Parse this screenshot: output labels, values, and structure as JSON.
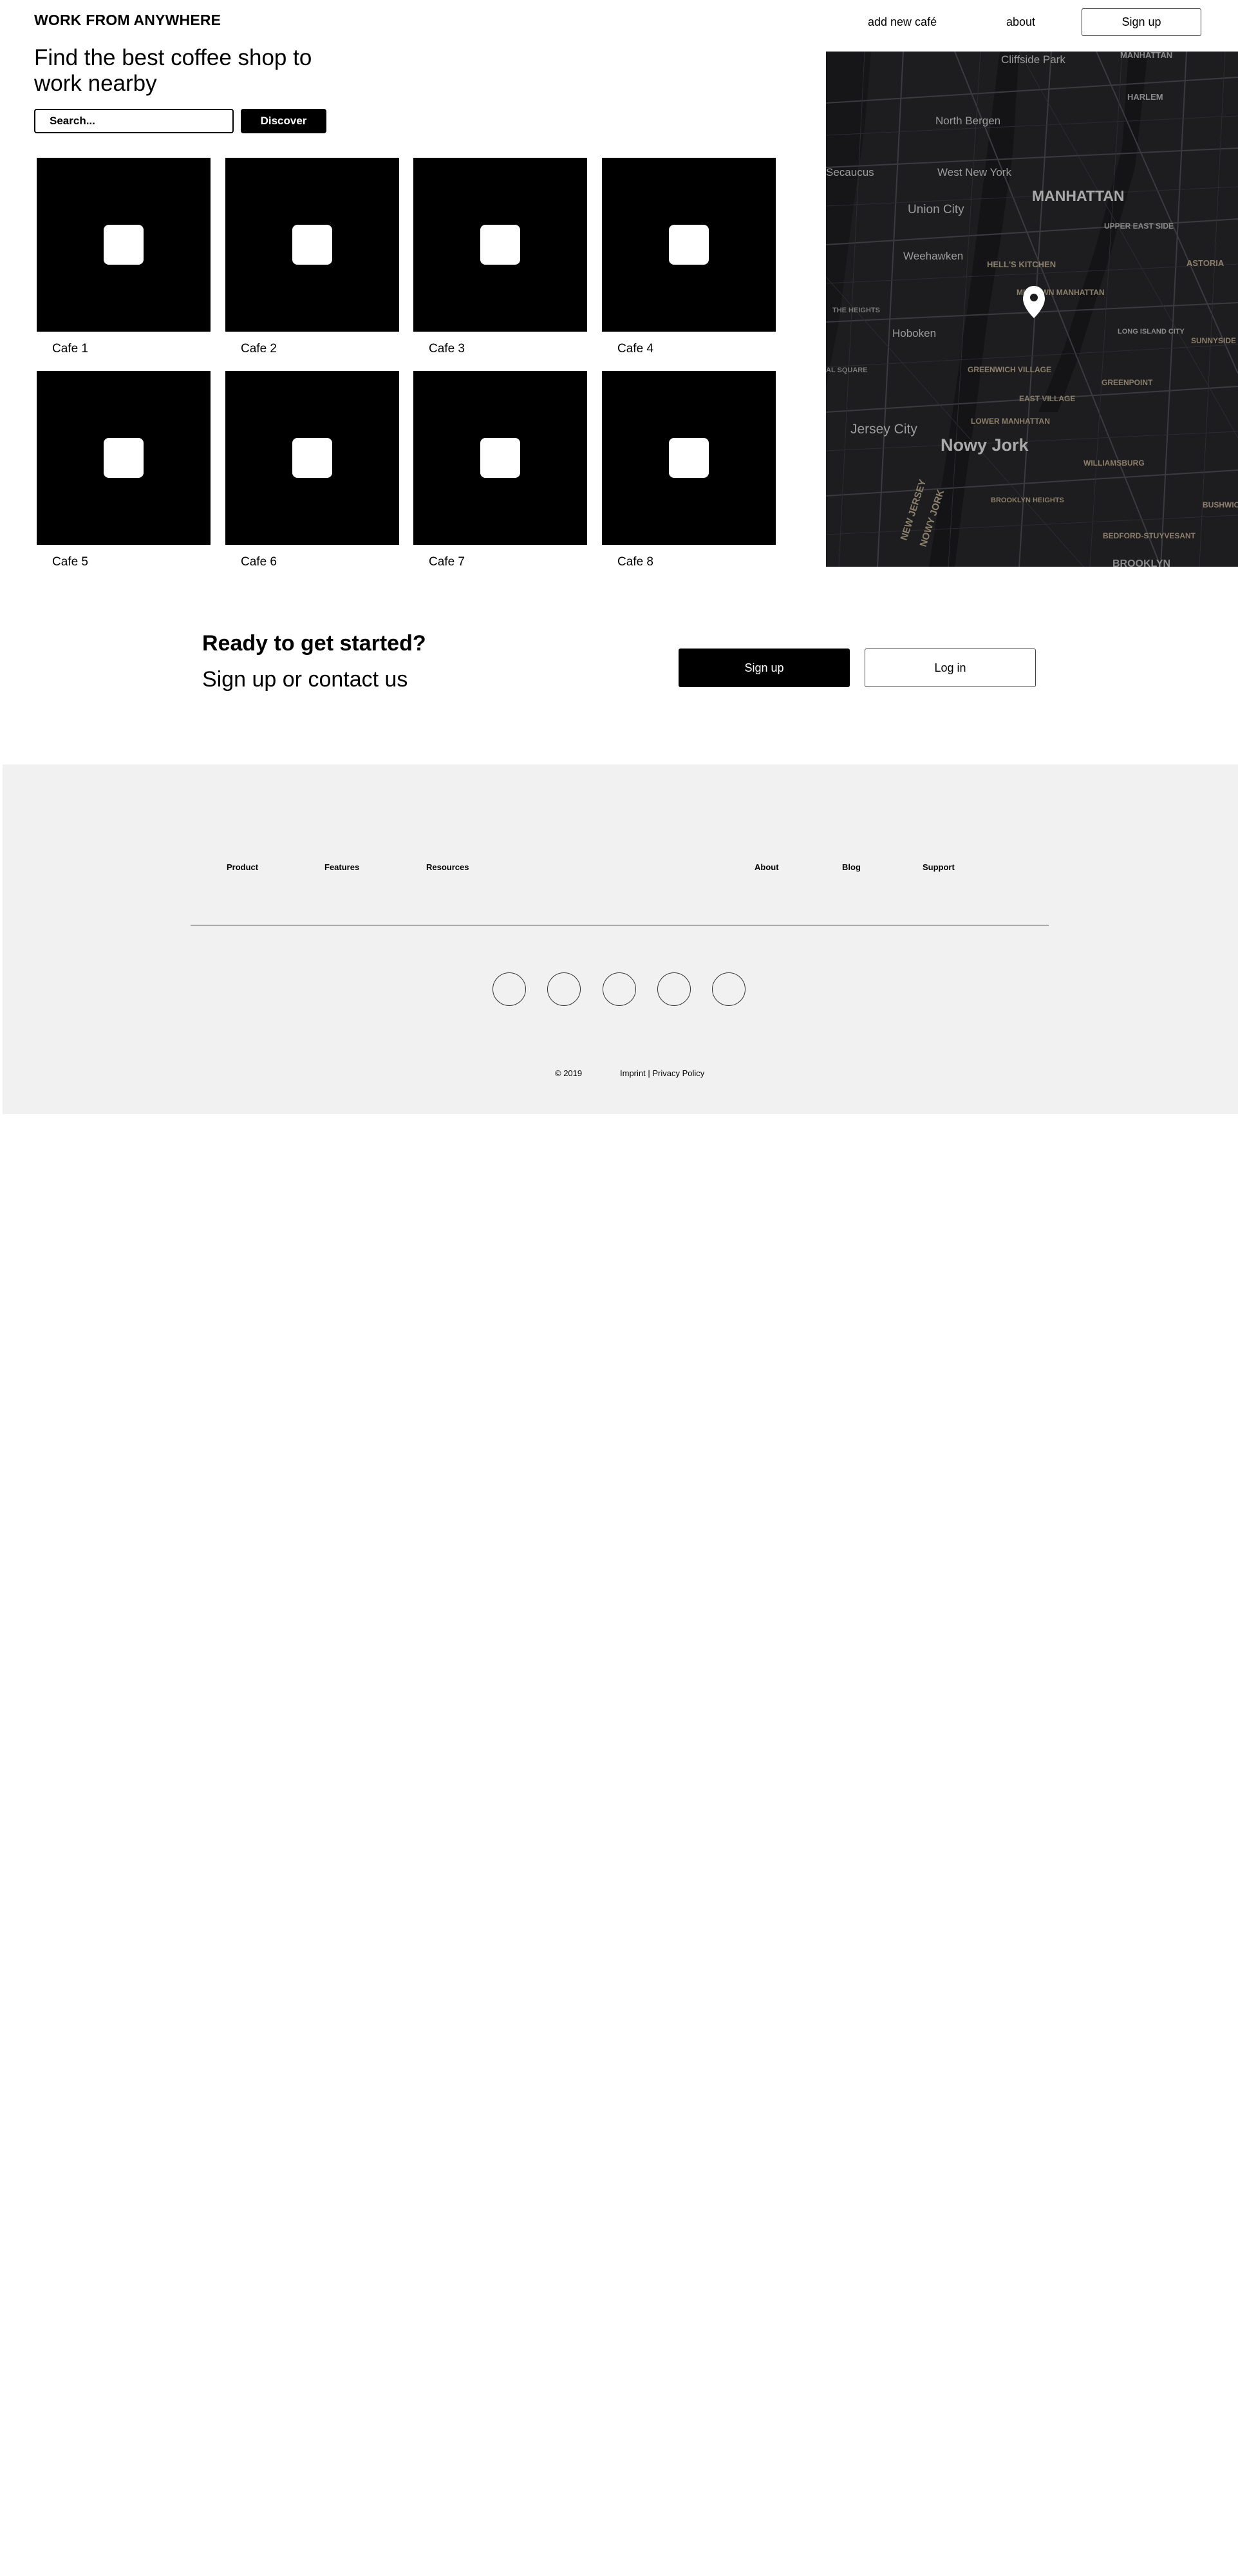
{
  "header": {
    "logo": "WORK FROM ANYWHERE",
    "nav": {
      "add_cafe": "add new café",
      "about": "about"
    },
    "signup": "Sign up"
  },
  "hero": {
    "title": "Find the best coffee shop to work nearby",
    "search_placeholder": "Search...",
    "discover": "Discover"
  },
  "cafes": [
    {
      "name": "Cafe 1"
    },
    {
      "name": "Cafe 2"
    },
    {
      "name": "Cafe 3"
    },
    {
      "name": "Cafe 4"
    },
    {
      "name": "Cafe 5"
    },
    {
      "name": "Cafe 6"
    },
    {
      "name": "Cafe 7"
    },
    {
      "name": "Cafe 8"
    }
  ],
  "map": {
    "labels": {
      "cliffside_park": "Cliffside Park",
      "manhattan_top": "MANHATTAN",
      "harlem": "HARLEM",
      "north_bergen": "North Bergen",
      "secaucus": "Secaucus",
      "west_new_york": "West New York",
      "manhattan": "MANHATTAN",
      "union_city": "Union City",
      "upper_east_side": "UPPER EAST SIDE",
      "weehawken": "Weehawken",
      "hells_kitchen": "HELL'S KITCHEN",
      "astoria": "ASTORIA",
      "midtown_manhattan": "MIDTOWN MANHATTAN",
      "the_heights": "THE HEIGHTS",
      "hoboken": "Hoboken",
      "long_island_city": "LONG ISLAND CITY",
      "sunnyside": "SUNNYSIDE",
      "greenwich_village": "GREENWICH VILLAGE",
      "greenpoint": "GREENPOINT",
      "square": "AL SQUARE",
      "east_village": "EAST VILLAGE",
      "lower_manhattan": "LOWER MANHATTAN",
      "jersey_city": "Jersey City",
      "nowy_jork": "Nowy Jork",
      "williamsburg": "WILLIAMSBURG",
      "new_jersey": "NEW JERSEY",
      "nowy_jork_rot": "NOWY JORK",
      "brooklyn_heights": "BROOKLYN HEIGHTS",
      "bushwick": "BUSHWICK",
      "bedford": "BEDFORD-STUYVESANT",
      "brooklyn": "BROOKLYN"
    },
    "pin_icon": "map-pin-icon"
  },
  "cta": {
    "title": "Ready to get started?",
    "subtitle": "Sign up or contact us",
    "signup": "Sign up",
    "login": "Log in"
  },
  "footer": {
    "links_left": [
      "Product",
      "Features",
      "Resources"
    ],
    "links_right": [
      "About",
      "Blog",
      "Support"
    ],
    "social_icons": [
      "social-icon-1",
      "social-icon-2",
      "social-icon-3",
      "social-icon-4",
      "social-icon-5"
    ],
    "copyright": "© 2019",
    "imprint": "Imprint",
    "separator": " | ",
    "privacy": "Privacy Policy"
  },
  "colors": {
    "dark": "#000000",
    "map_bg": "#1d1d20",
    "footer_bg": "#f1f1f1"
  }
}
